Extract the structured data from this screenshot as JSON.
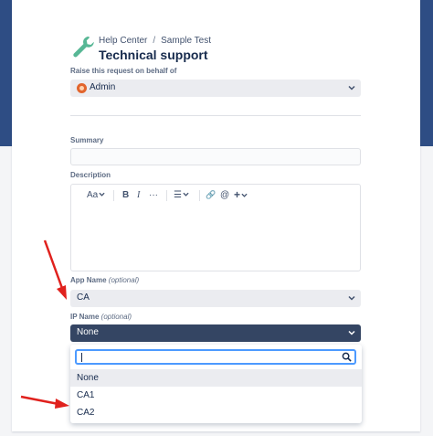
{
  "breadcrumb": {
    "home": "Help Center",
    "separator": "/",
    "project": "Sample Test"
  },
  "page_title": "Technical support",
  "on_behalf": {
    "label": "Raise this request on behalf of",
    "value": "Admin"
  },
  "summary": {
    "label": "Summary",
    "value": ""
  },
  "description": {
    "label": "Description",
    "toolbar": {
      "text_style": "Aa",
      "bold": "B",
      "italic": "I",
      "more": "···",
      "list": "☰",
      "link": "🔗",
      "mention": "@",
      "insert": "+"
    }
  },
  "app_name": {
    "label": "App Name",
    "optional": "(optional)",
    "value": "CA"
  },
  "ip_name": {
    "label": "IP Name",
    "optional": "(optional)",
    "value": "None",
    "options": [
      "None",
      "CA1",
      "CA2"
    ]
  },
  "colors": {
    "header_band": "#2e4d84",
    "accent": "#4c9aff",
    "arrow": "#e0211d",
    "logo": "#57b795"
  }
}
